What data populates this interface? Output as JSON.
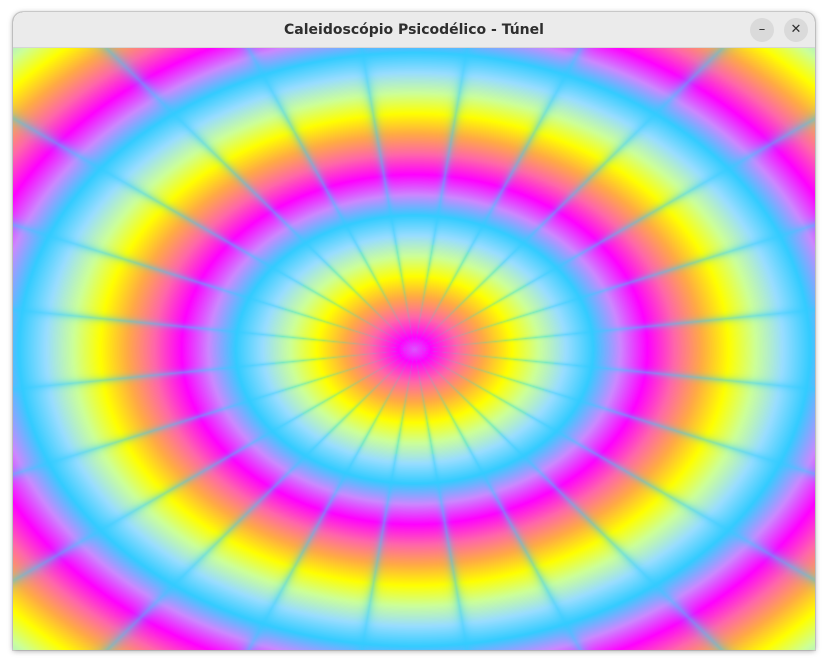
{
  "window": {
    "title": "Caleidoscópio Psicodélico - Túnel"
  },
  "controls": {
    "minimize_glyph": "–",
    "close_glyph": "✕"
  },
  "visual": {
    "palette": [
      "#ffff00",
      "#ccff99",
      "#99ddff",
      "#33ccff",
      "#cc88ff",
      "#ff00ff",
      "#ff66aa",
      "#ffaa44"
    ],
    "ray_count": 24,
    "ray_color": "#33ccff",
    "center_ray_color": "#33ddcc"
  }
}
